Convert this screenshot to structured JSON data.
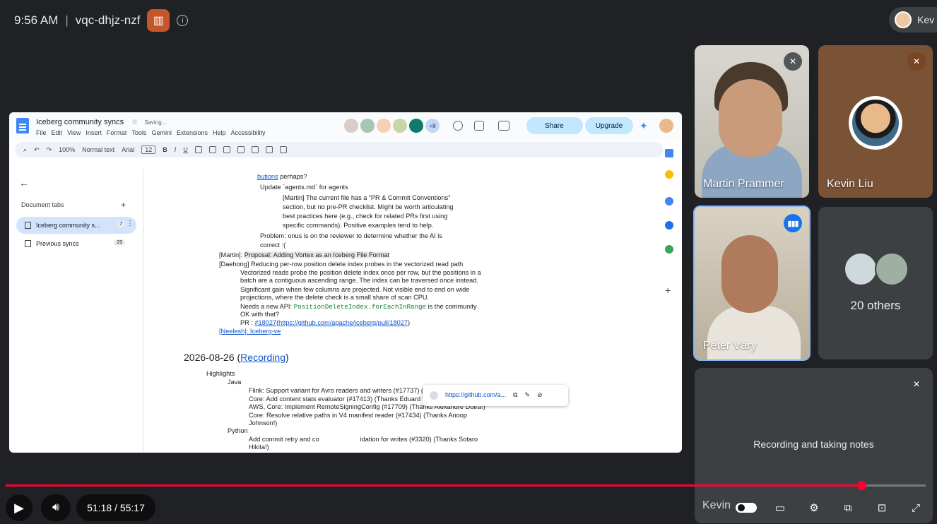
{
  "meet": {
    "time": "9:56 AM",
    "separator": "|",
    "code": "vqc-dhjz-nzf",
    "user_chip": "Kev"
  },
  "doc": {
    "title": "Iceberg community syncs",
    "status": "Saving...",
    "menu": [
      "File",
      "Edit",
      "View",
      "Insert",
      "Format",
      "Tools",
      "Gemini",
      "Extensions",
      "Help",
      "Accessibility"
    ],
    "avatars_more": "+8",
    "share": "Share",
    "upgrade": "Upgrade",
    "toolbar": {
      "zoom": "100%",
      "style": "Normal text",
      "font": "Arial",
      "size": "12"
    },
    "sidebar": {
      "title": "Document tabs",
      "tabs": [
        {
          "label": "Iceberg community s...",
          "count": "7"
        },
        {
          "label": "Previous syncs",
          "count": "29"
        }
      ]
    },
    "lines": {
      "l1": "butions",
      "l1b": " perhaps?",
      "l2": "Update `agents.md` for agents",
      "l3": "[Martin] The current file has a “PR & Commit Conventions”",
      "l4": "section, but no pre-PR checklist. Might be worth articulating",
      "l5": "best practices here (e.g., check for related PRs first using",
      "l6": "specific commands). Positive examples tend to help.",
      "l7": "Problem: onus is on the reviewer to determine whether the AI is",
      "l8": "correct :(",
      "l9a": "[Martin]: ",
      "l9b": "Proposal: Adding Vortex as an Iceberg File Format",
      "l10": "[Daehong] Reducing per-row position delete index probes in the vectorized read path",
      "l11": "Vectorized reads probe the position delete index once per row, but the positions in a",
      "l12": "batch are a contiguous ascending range. The index can be traversed once instead.",
      "l13": "Significant gain when few columns are projected. Not visible end to end on wide",
      "l14": "projections, where the delete check is a small share of scan CPU.",
      "l15a": "Needs a new API: ",
      "l15b": "PositionDeleteIndex.forEachInRange",
      "l15c": " is the community",
      "l16": "OK with that?",
      "l17a": "PR : ",
      "l17b": "#18027",
      "l17c": "https://github.com/apache/iceberg/pull/18027",
      "l18": "[Neelesh]: Iceberg-ve",
      "date_a": "2026-08-26 (",
      "date_b": "Recording",
      "date_c": ")",
      "h1": "Highlights",
      "h2": "Java",
      "j1": "Flink: Support variant for Avro readers and writers (#17737) (Thanks GuoYu!)",
      "j2": "Core: Add content stats evaluator (#17413) (Thanks Eduard Tudenhoefner!)",
      "j3": "AWS, Core: Implement RemoteSigningConfig (#17709) (Thanks Alexandre Dutra!)",
      "j4": "Core: Resolve relative paths in V4 manifest reader (#17434) (Thanks Anoop",
      "j5": "Johnson!)",
      "h3": "Python",
      "p1": "Add commit retry and co",
      "p1b": "idation for writes (#3320) (Thanks Sotaro",
      "p2": "Hikita!)"
    },
    "popup_url": "https://github.com/a..."
  },
  "participants": [
    {
      "name": "Martin Prammer"
    },
    {
      "name": "Kevin Liu"
    },
    {
      "name": "Péter Váry"
    },
    {
      "name": "20 others"
    }
  ],
  "notes_tile": "Recording and taking notes",
  "player": {
    "time": "51:18 / 55:17",
    "overlay_name": "Kevin",
    "progress_percent": 93
  },
  "colors": {
    "accent": "#ff0033",
    "speaking": "#1a73e8",
    "bg": "#202124"
  },
  "icons": [
    "info-icon",
    "play-icon",
    "volume-icon",
    "mic-off-icon",
    "speaking-icon",
    "settings-icon",
    "captions-icon",
    "fullscreen-icon",
    "cast-icon",
    "miniplayer-icon"
  ]
}
